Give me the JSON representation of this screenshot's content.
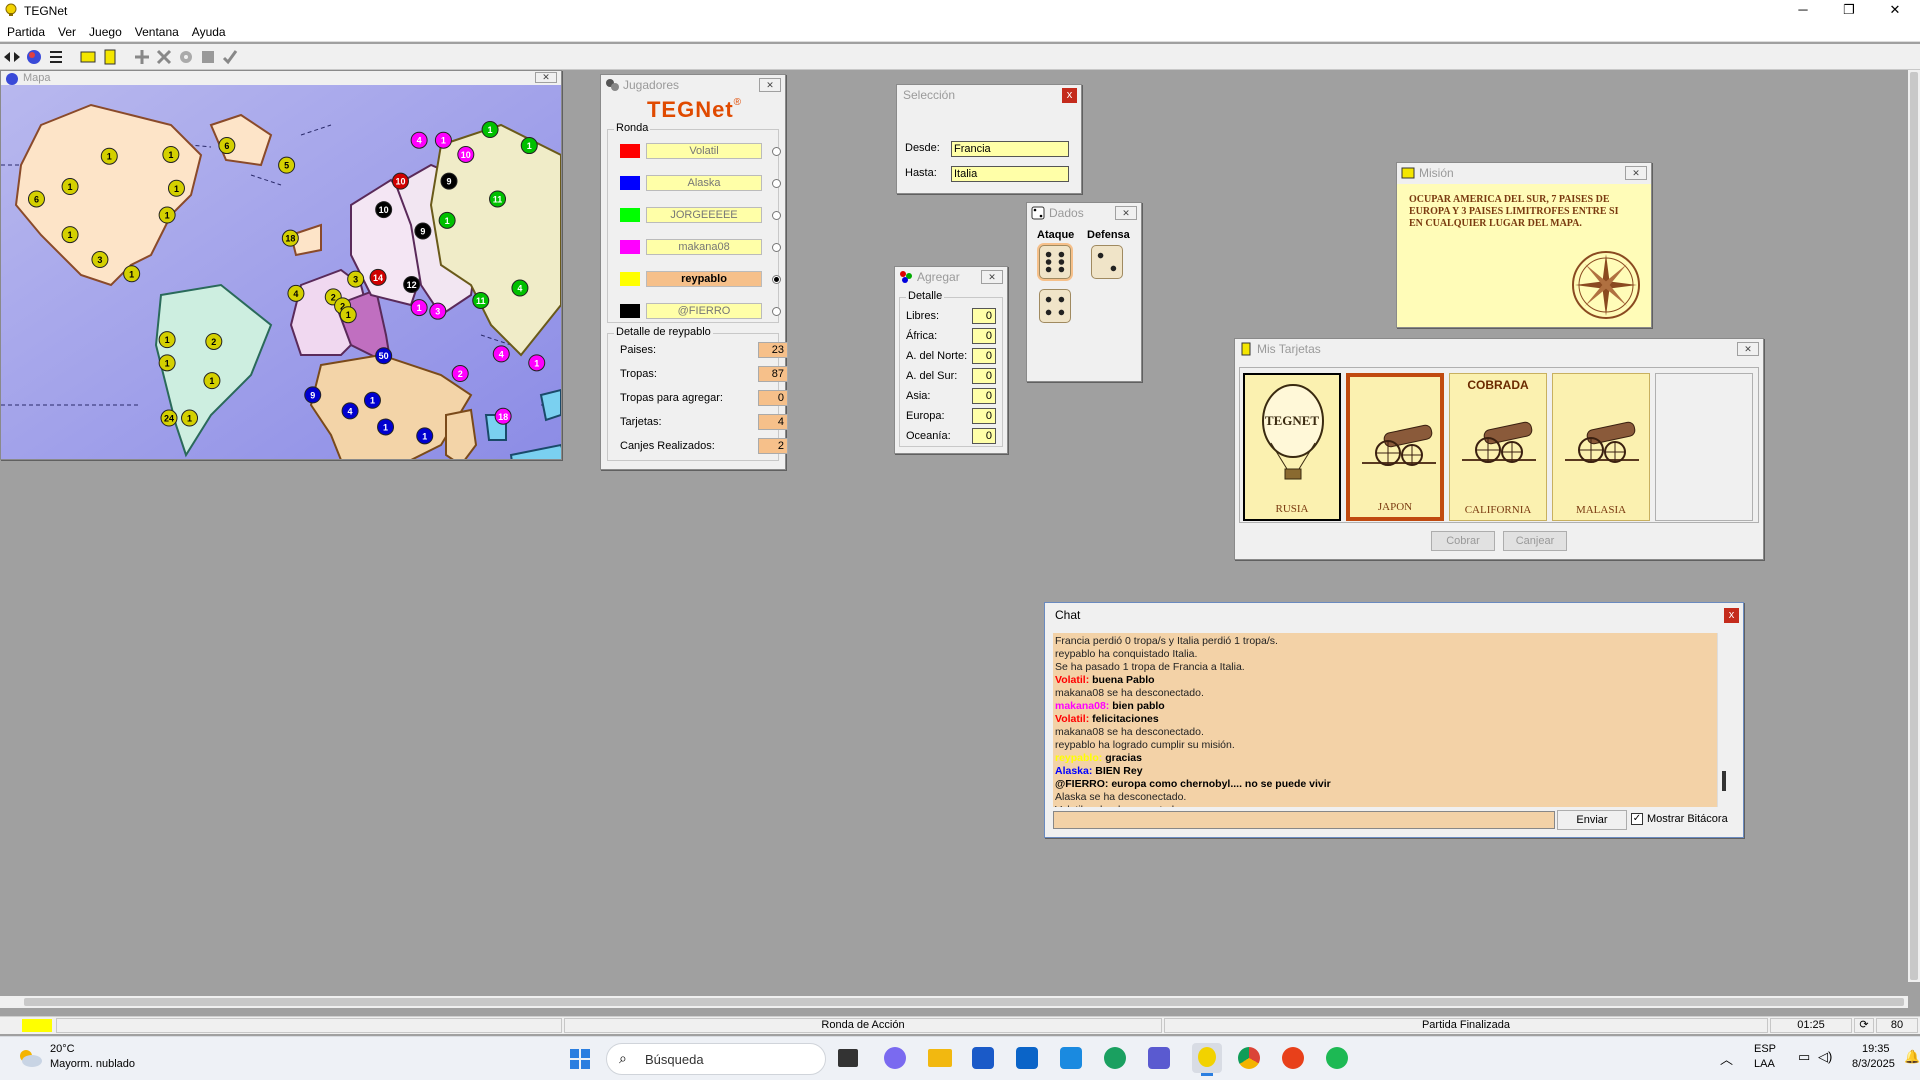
{
  "app": {
    "title": "TEGNet"
  },
  "menu": [
    "Partida",
    "Ver",
    "Juego",
    "Ventana",
    "Ayuda"
  ],
  "map_window": {
    "title": "Mapa",
    "armies": [
      {
        "n": "1",
        "color": "#d4d000"
      },
      {
        "n": "6",
        "color": "#d4d000"
      },
      {
        "n": "1",
        "color": "#d4d000"
      },
      {
        "n": "1",
        "color": "#d4d000"
      },
      {
        "n": "1",
        "color": "#d4d000"
      },
      {
        "n": "6",
        "color": "#d4d000"
      },
      {
        "n": "1",
        "color": "#d4d000"
      },
      {
        "n": "3",
        "color": "#d4d000"
      },
      {
        "n": "1",
        "color": "#d4d000"
      },
      {
        "n": "1",
        "color": "#d4d000"
      },
      {
        "n": "5",
        "color": "#d4d000"
      },
      {
        "n": "18",
        "color": "#d4d000"
      },
      {
        "n": "2",
        "color": "#d4d000"
      },
      {
        "n": "4",
        "color": "#d4d000"
      },
      {
        "n": "2",
        "color": "#d4d000"
      },
      {
        "n": "3",
        "color": "#d4d000"
      },
      {
        "n": "1",
        "color": "#d4d000"
      },
      {
        "n": "10",
        "color": "#000000"
      },
      {
        "n": "14",
        "color": "#d00000"
      },
      {
        "n": "10",
        "color": "#d00000"
      },
      {
        "n": "4",
        "color": "#ff00ff"
      },
      {
        "n": "1",
        "color": "#ff00ff"
      },
      {
        "n": "10",
        "color": "#ff00ff"
      },
      {
        "n": "9",
        "color": "#000000"
      },
      {
        "n": "9",
        "color": "#000000"
      },
      {
        "n": "12",
        "color": "#000000"
      },
      {
        "n": "1",
        "color": "#ff00ff"
      },
      {
        "n": "3",
        "color": "#ff00ff"
      },
      {
        "n": "1",
        "color": "#00c000"
      },
      {
        "n": "1",
        "color": "#00c000"
      },
      {
        "n": "11",
        "color": "#00c000"
      },
      {
        "n": "1",
        "color": "#00c000"
      },
      {
        "n": "11",
        "color": "#00c000"
      },
      {
        "n": "4",
        "color": "#00c000"
      },
      {
        "n": "1",
        "color": "#d4d000"
      },
      {
        "n": "2",
        "color": "#d4d000"
      },
      {
        "n": "1",
        "color": "#d4d000"
      },
      {
        "n": "1",
        "color": "#d4d000"
      },
      {
        "n": "24",
        "color": "#d4d000"
      },
      {
        "n": "1",
        "color": "#d4d000"
      },
      {
        "n": "9",
        "color": "#0000d0"
      },
      {
        "n": "50",
        "color": "#0000d0"
      },
      {
        "n": "1",
        "color": "#0000d0"
      },
      {
        "n": "4",
        "color": "#0000d0"
      },
      {
        "n": "1",
        "color": "#0000d0"
      },
      {
        "n": "1",
        "color": "#0000d0"
      },
      {
        "n": "2",
        "color": "#ff00ff"
      },
      {
        "n": "4",
        "color": "#ff00ff"
      },
      {
        "n": "1",
        "color": "#ff00ff"
      },
      {
        "n": "18",
        "color": "#ff00ff"
      }
    ]
  },
  "jugadores": {
    "title": "Jugadores",
    "logo": "TEGNet",
    "ronda_label": "Ronda",
    "players": [
      {
        "name": "Volatil",
        "color": "#ff0000",
        "selected": false
      },
      {
        "name": "Alaska",
        "color": "#0000ff",
        "selected": false
      },
      {
        "name": "JORGEEEEE",
        "color": "#00ff00",
        "selected": false
      },
      {
        "name": "makana08",
        "color": "#ff00ff",
        "selected": false
      },
      {
        "name": "reypablo",
        "color": "#ffff00",
        "selected": true
      },
      {
        "name": "@FIERRO",
        "color": "#000000",
        "selected": false
      }
    ],
    "detail_label": "Detalle de reypablo",
    "details": [
      {
        "label": "Paises:",
        "value": "23"
      },
      {
        "label": "Tropas:",
        "value": "87"
      },
      {
        "label": "Tropas para agregar:",
        "value": "0"
      },
      {
        "label": "Tarjetas:",
        "value": "4"
      },
      {
        "label": "Canjes Realizados:",
        "value": "2"
      }
    ]
  },
  "seleccion": {
    "title": "Selección",
    "desde_label": "Desde:",
    "desde_value": "Francia",
    "hasta_label": "Hasta:",
    "hasta_value": "Italia"
  },
  "dados": {
    "title": "Dados",
    "ataque_label": "Ataque",
    "defensa_label": "Defensa",
    "ataque": [
      6,
      4
    ],
    "defensa": [
      2
    ]
  },
  "agregar": {
    "title": "Agregar",
    "detalle_label": "Detalle",
    "rows": [
      {
        "label": "Libres:",
        "value": "0"
      },
      {
        "label": "África:",
        "value": "0"
      },
      {
        "label": "A. del Norte:",
        "value": "0"
      },
      {
        "label": "A. del Sur:",
        "value": "0"
      },
      {
        "label": "Asia:",
        "value": "0"
      },
      {
        "label": "Europa:",
        "value": "0"
      },
      {
        "label": "Oceanía:",
        "value": "0"
      }
    ]
  },
  "mision": {
    "title": "Misión",
    "text": "OCUPAR AMERICA DEL SUR, 7 PAISES DE EUROPA Y 3 PAISES LIMITROFES ENTRE SI EN CUALQUIER LUGAR DEL MAPA."
  },
  "tarjetas": {
    "title": "Mis Tarjetas",
    "cards": [
      {
        "name": "RUSIA",
        "top": "",
        "kind": "balloon",
        "logo": "TEGNET",
        "selected": false
      },
      {
        "name": "JAPON",
        "top": "",
        "kind": "cannon",
        "logo": "",
        "selected": true
      },
      {
        "name": "CALIFORNIA",
        "top": "COBRADA",
        "kind": "cannon",
        "logo": "",
        "selected": false
      },
      {
        "name": "MALASIA",
        "top": "",
        "kind": "cannon",
        "logo": "",
        "selected": false
      }
    ],
    "cobrar_label": "Cobrar",
    "canjear_label": "Canjear"
  },
  "chat": {
    "title": "Chat",
    "lines": [
      {
        "who": "",
        "text": "Francia perdió 0 tropa/s y Italia perdió 1 tropa/s.",
        "color": "#000000"
      },
      {
        "who": "",
        "text": "reypablo ha conquistado Italia.",
        "color": "#000000"
      },
      {
        "who": "",
        "text": "Se ha pasado 1 tropa de Francia a Italia.",
        "color": "#000000"
      },
      {
        "who": "Volatil:",
        "text": "buena Pablo",
        "color": "#ff0000"
      },
      {
        "who": "",
        "text": "makana08 se ha desconectado.",
        "color": "#000000"
      },
      {
        "who": "makana08:",
        "text": "bien pablo",
        "color": "#ff00ff"
      },
      {
        "who": "Volatil:",
        "text": "felicitaciones",
        "color": "#ff0000"
      },
      {
        "who": "",
        "text": "makana08 se ha desconectado.",
        "color": "#000000"
      },
      {
        "who": "",
        "text": "reypablo ha logrado cumplir su misión.",
        "color": "#000000"
      },
      {
        "who": "reypablo:",
        "text": "gracias",
        "color": "#ffff00"
      },
      {
        "who": "Alaska:",
        "text": "BIEN      Rey",
        "color": "#0000ff"
      },
      {
        "who": "@FIERRO:",
        "text": "europa como chernobyl.... no se puede vivir",
        "color": "#000000"
      },
      {
        "who": "",
        "text": "Alaska se ha desconectado.",
        "color": "#000000"
      },
      {
        "who": "",
        "text": "Volatil se ha desconectado.",
        "color": "#000000"
      }
    ],
    "send_label": "Enviar",
    "mostrar_label": "Mostrar Bitácora",
    "mostrar_checked": true
  },
  "status": {
    "ronda": "Ronda de Acción",
    "partida": "Partida Finalizada",
    "time": "01:25",
    "count": "80",
    "player_color": "#ffff00"
  },
  "taskbar": {
    "weather_temp": "20°C",
    "weather_desc": "Mayorm. nublado",
    "search_placeholder": "Búsqueda",
    "lang1": "ESP",
    "lang2": "LAA",
    "clock_time": "19:35",
    "clock_date": "8/3/2025"
  }
}
